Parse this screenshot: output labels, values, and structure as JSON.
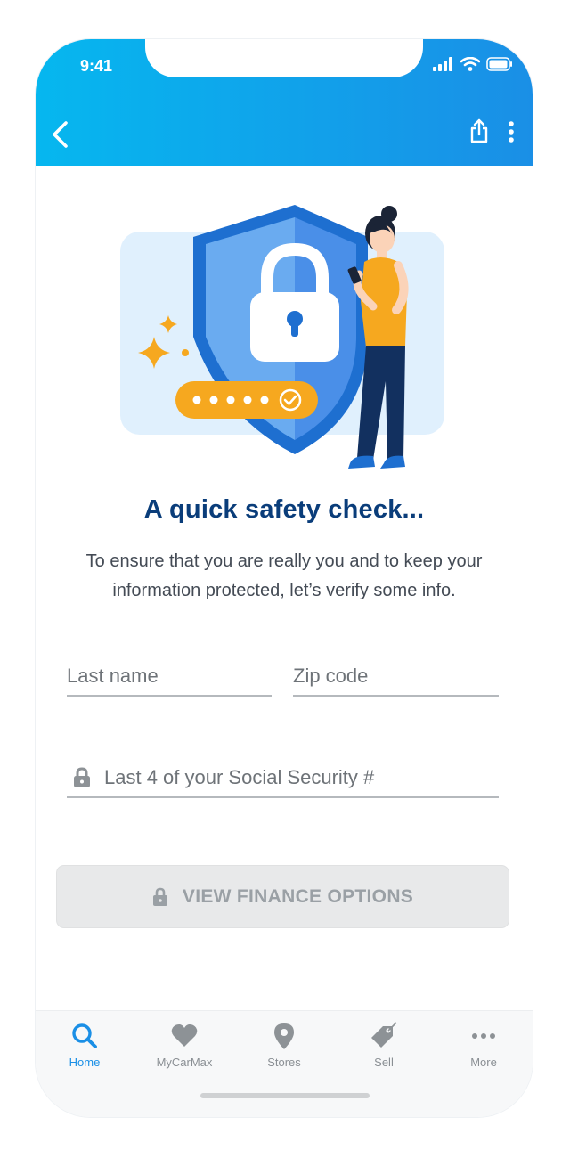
{
  "status_bar": {
    "time": "9:41"
  },
  "header": {
    "back_icon": "chevron-left-icon",
    "share_icon": "share-icon",
    "more_icon": "more-vertical-icon",
    "gradient_start": "#06b7ef",
    "gradient_end": "#1a8fe6"
  },
  "main": {
    "title": "A quick safety check...",
    "description": "To ensure that you are really you and to keep your information protected, let’s verify some info.",
    "fields": {
      "last_name_placeholder": "Last name",
      "zip_placeholder": "Zip code",
      "ssn_placeholder": "Last 4 of your Social Security #"
    },
    "cta_label": "VIEW FINANCE OPTIONS"
  },
  "tabbar": {
    "items": [
      {
        "label": "Home",
        "icon": "search-icon",
        "active": true
      },
      {
        "label": "MyCarMax",
        "icon": "heart-icon",
        "active": false
      },
      {
        "label": "Stores",
        "icon": "location-pin-icon",
        "active": false
      },
      {
        "label": "Sell",
        "icon": "price-tag-icon",
        "active": false
      },
      {
        "label": "More",
        "icon": "more-horizontal-icon",
        "active": false
      }
    ]
  },
  "colors": {
    "title": "#0a3d7a",
    "accent_blue": "#1a8fe6",
    "illustration_orange": "#f6a81f"
  }
}
